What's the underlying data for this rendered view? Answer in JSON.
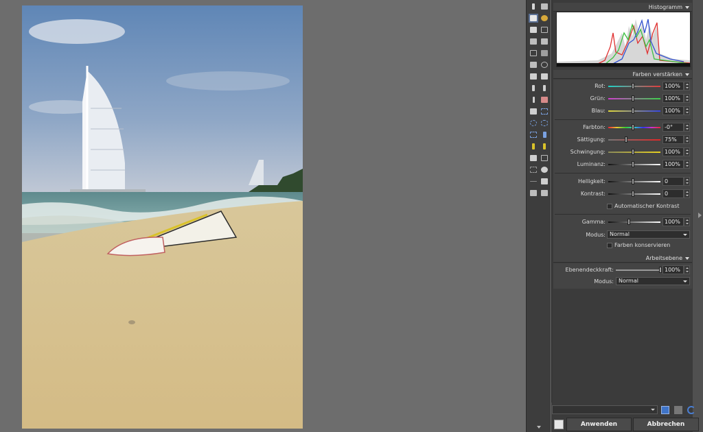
{
  "histogram": {
    "title": "Histogramm"
  },
  "enhance": {
    "title": "Farben verstärken",
    "rows": [
      {
        "label": "Rot:",
        "value": "100%"
      },
      {
        "label": "Grün:",
        "value": "100%"
      },
      {
        "label": "Blau:",
        "value": "100%"
      },
      {
        "label": "Farbton:",
        "value": "-0°"
      },
      {
        "label": "Sättigung:",
        "value": "75%"
      },
      {
        "label": "Schwingung:",
        "value": "100%"
      },
      {
        "label": "Luminanz:",
        "value": "100%"
      },
      {
        "label": "Helligkeit:",
        "value": "0"
      },
      {
        "label": "Kontrast:",
        "value": "0"
      },
      {
        "label": "Gamma:",
        "value": "100%"
      }
    ],
    "auto_contrast": "Automatischer Kontrast",
    "mode_label": "Modus:",
    "mode_value": "Normal",
    "preserve_colors": "Farben konservieren"
  },
  "layer": {
    "title": "Arbeitsebene",
    "opacity_label": "Ebenendeckkraft:",
    "opacity_value": "100%",
    "mode_label": "Modus:",
    "mode_value": "Normal"
  },
  "buttons": {
    "apply": "Anwenden",
    "cancel": "Abbrechen"
  },
  "colors": {
    "panel": "#3b3b3b",
    "section": "#444444",
    "active_tool": "#5a6f93"
  }
}
